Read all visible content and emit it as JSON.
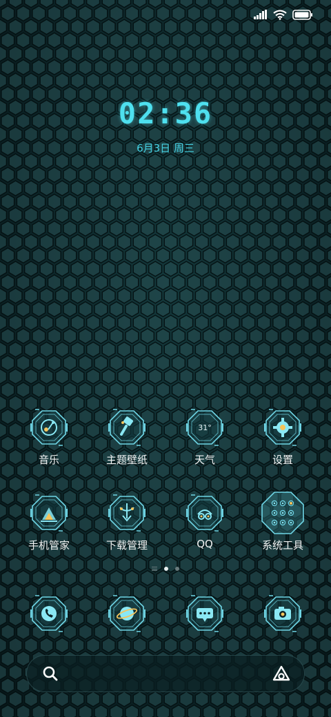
{
  "status_bar": {
    "signal_icon": "signal-icon",
    "wifi_icon": "wifi-icon",
    "battery_icon": "battery-icon"
  },
  "clock": {
    "time": "02:36",
    "date": "6月3日 周三"
  },
  "apps": [
    {
      "label": "音乐",
      "icon": "music-icon"
    },
    {
      "label": "主题壁纸",
      "icon": "theme-brush-icon"
    },
    {
      "label": "天气",
      "icon": "weather-icon",
      "badge": "31°"
    },
    {
      "label": "设置",
      "icon": "gear-icon"
    },
    {
      "label": "手机管家",
      "icon": "phone-manager-icon"
    },
    {
      "label": "下载管理",
      "icon": "download-icon"
    },
    {
      "label": "QQ",
      "icon": "qq-icon"
    },
    {
      "label": "系统工具",
      "icon": "system-tools-folder-icon"
    }
  ],
  "page_indicator": {
    "pages": 2,
    "active": 0
  },
  "dock": [
    {
      "name": "phone",
      "icon": "phone-icon"
    },
    {
      "name": "browser",
      "icon": "browser-icon"
    },
    {
      "name": "messages",
      "icon": "message-icon"
    },
    {
      "name": "camera",
      "icon": "camera-icon"
    }
  ],
  "search": {
    "placeholder": "",
    "search_icon": "search-icon",
    "assistant_icon": "assistant-icon"
  },
  "colors": {
    "accent": "#4ee0ef",
    "icon_line": "#6fd6e6",
    "icon_fill": "#8ae8f4",
    "icon_gold": "#f4c45c",
    "text": "#f2f4f4",
    "background": "#0d2528"
  }
}
